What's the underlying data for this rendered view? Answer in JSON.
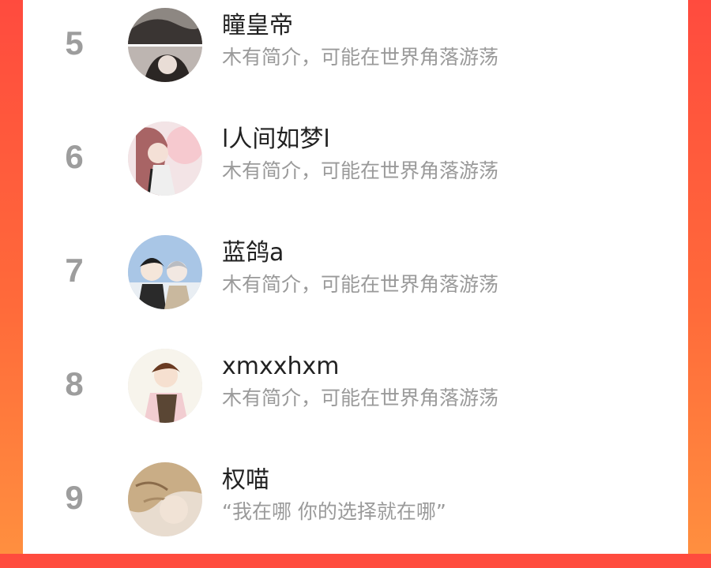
{
  "ranking": {
    "items": [
      {
        "rank": "5",
        "name": "瞳皇帝",
        "bio": "木有简介，可能在世界角落游荡"
      },
      {
        "rank": "6",
        "name": "l人间如梦l",
        "bio": "木有简介，可能在世界角落游荡"
      },
      {
        "rank": "7",
        "name": "蓝鸽a",
        "bio": "木有简介，可能在世界角落游荡"
      },
      {
        "rank": "8",
        "name": "xmxxhxm",
        "bio": "木有简介，可能在世界角落游荡"
      },
      {
        "rank": "9",
        "name": "权喵",
        "bio": "“我在哪 你的选择就在哪”"
      }
    ]
  },
  "colors": {
    "background_gradient_top": "#ff4b3e",
    "background_gradient_bottom": "#ff8f3f",
    "rank_gray": "#9d9d9d",
    "name_text": "#222222",
    "bio_text": "#9a9a9a"
  }
}
